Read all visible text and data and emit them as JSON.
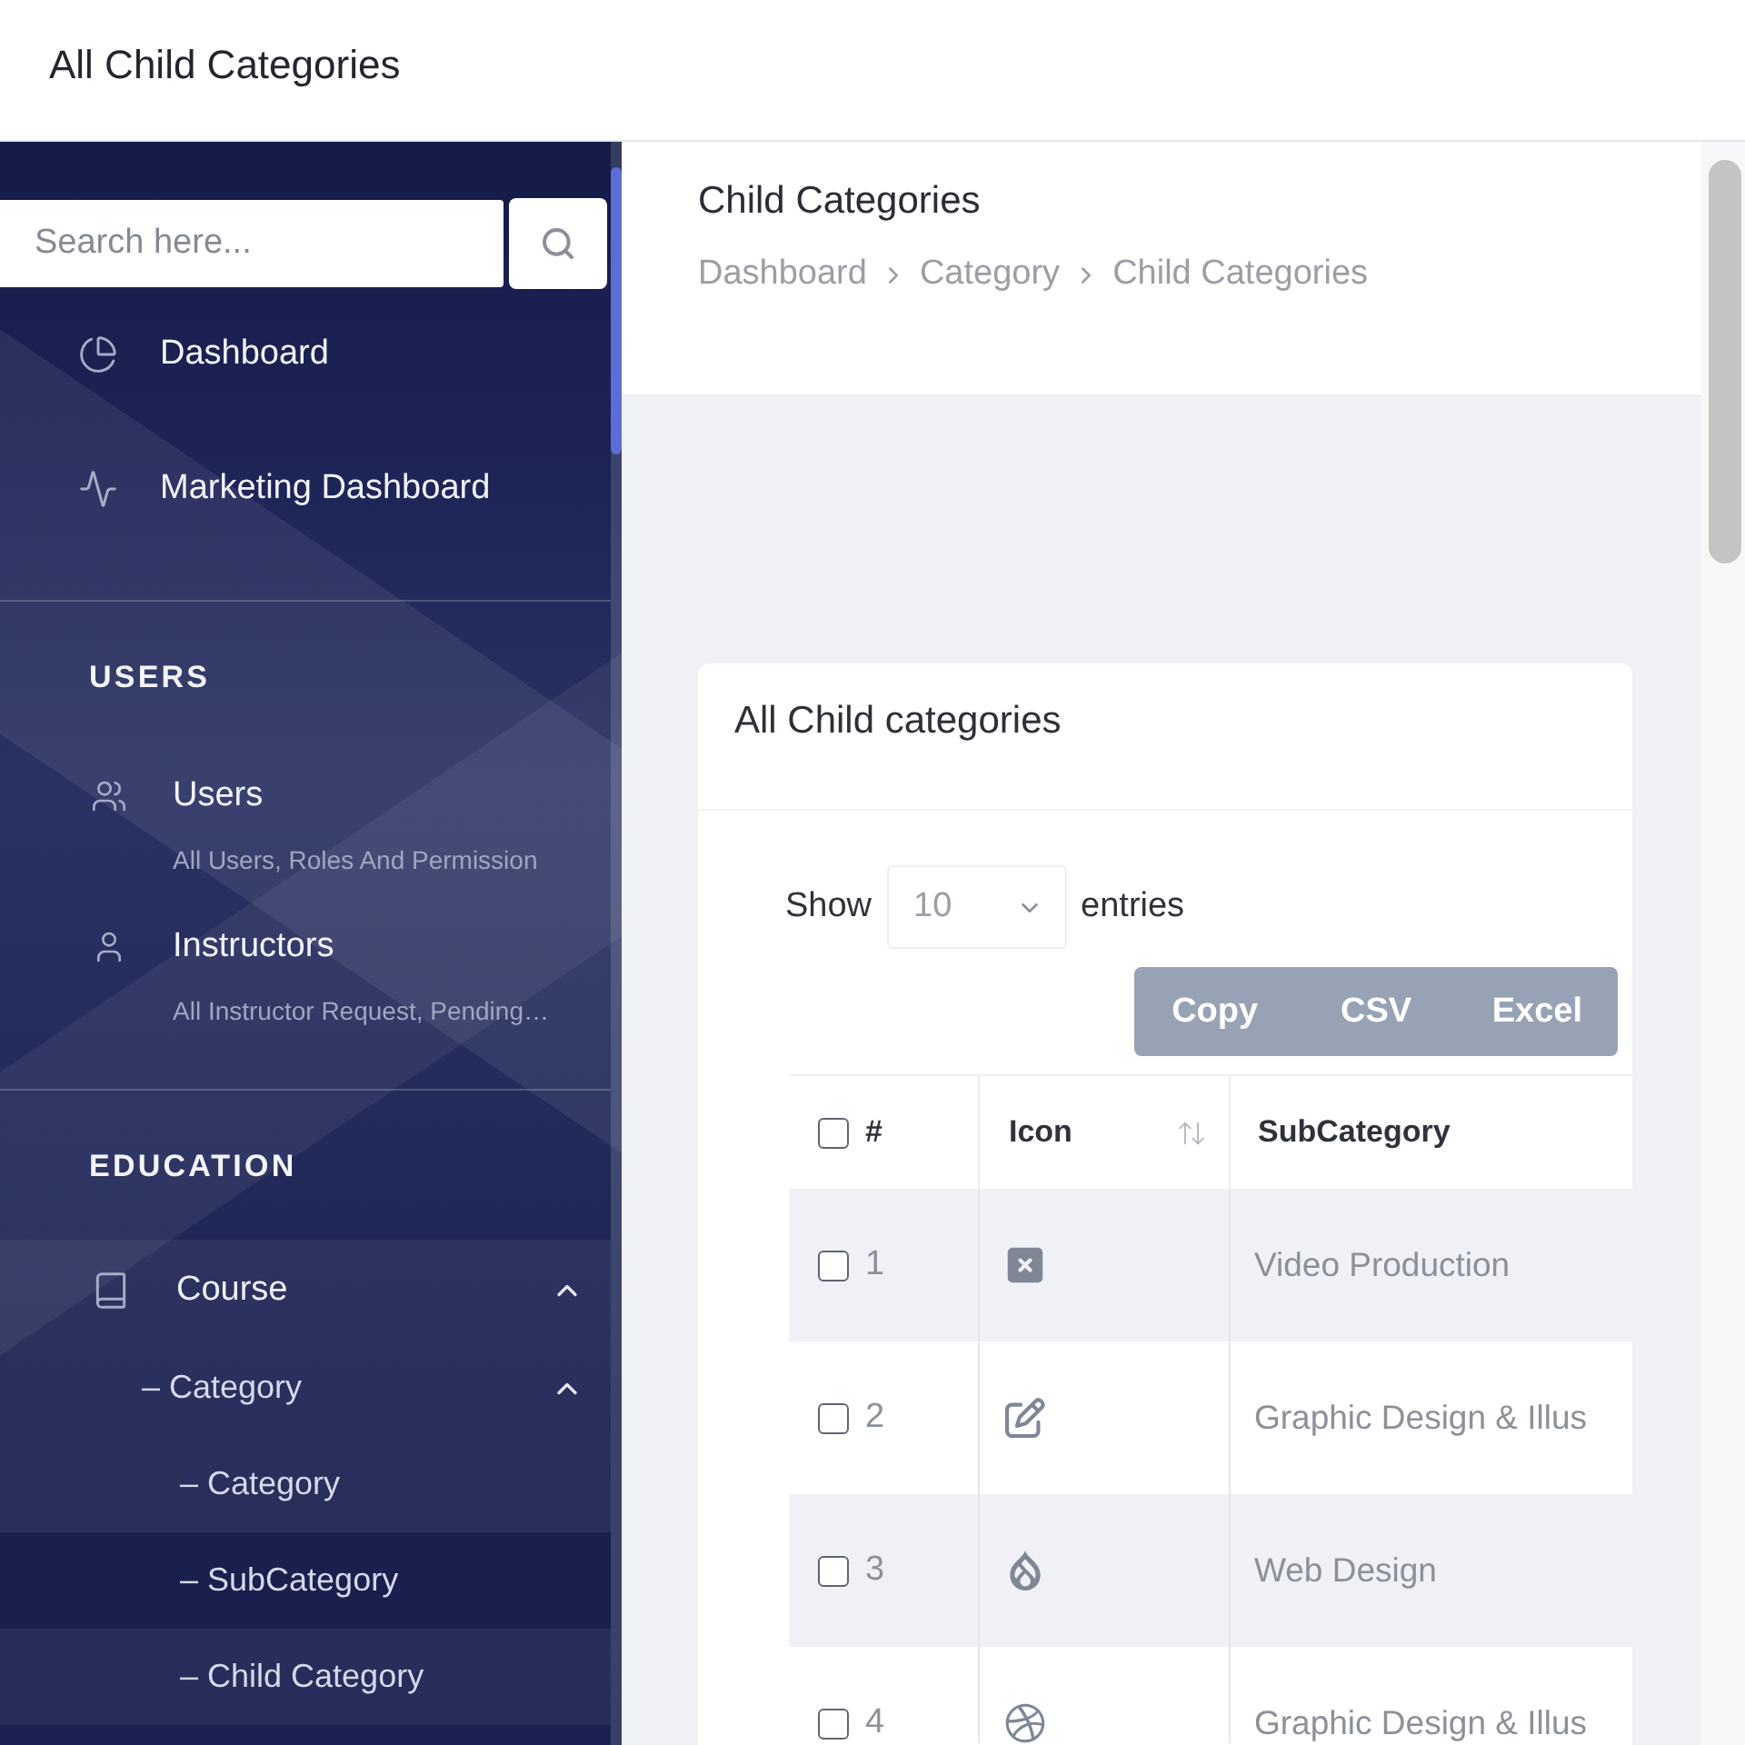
{
  "header": {
    "title": "All Child Categories"
  },
  "sidebar": {
    "search": {
      "placeholder": "Search here..."
    },
    "sections": [
      {
        "items": [
          {
            "label": "Dashboard",
            "selected": false
          },
          {
            "label": "Marketing Dashboard",
            "selected": false
          }
        ]
      },
      {
        "heading": "USERS",
        "items": [
          {
            "label": "Users",
            "subtitle": "All Users, Roles And Permission",
            "selected": false
          },
          {
            "label": "Instructors",
            "subtitle": "All Instructor Request, Pending…",
            "selected": false
          }
        ]
      },
      {
        "heading": "EDUCATION",
        "items": [
          {
            "label": "Course",
            "selected": false,
            "expanded": true,
            "children": [
              {
                "label": "– Category",
                "selected": false,
                "expanded": true,
                "children": [
                  {
                    "label": "– Category",
                    "selected": false
                  },
                  {
                    "label": "– SubCategory",
                    "selected": true
                  },
                  {
                    "label": "– Child Category",
                    "selected": false
                  }
                ]
              }
            ]
          }
        ]
      }
    ]
  },
  "page_header": {
    "title": "Child Categories",
    "breadcrumb": [
      "Dashboard",
      "Category",
      "Child Categories"
    ]
  },
  "card": {
    "title": "All Child categories",
    "length_menu": {
      "before": "Show",
      "value": "10",
      "after": "entries"
    },
    "export_buttons": [
      "Copy",
      "CSV",
      "Excel"
    ],
    "table": {
      "select_all": {
        "checked": false
      },
      "columns": [
        {
          "label": "#",
          "sortable": false
        },
        {
          "label": "Icon",
          "sortable": true
        },
        {
          "label": "SubCategory",
          "sortable": false
        }
      ],
      "rows": [
        {
          "checked": false,
          "number": "1",
          "subcategory": "Video Production"
        },
        {
          "checked": false,
          "number": "2",
          "subcategory": "Graphic Design & Illus"
        },
        {
          "checked": false,
          "number": "3",
          "subcategory": "Web Design"
        },
        {
          "checked": false,
          "number": "4",
          "subcategory": "Graphic Design & Illus"
        }
      ]
    }
  }
}
